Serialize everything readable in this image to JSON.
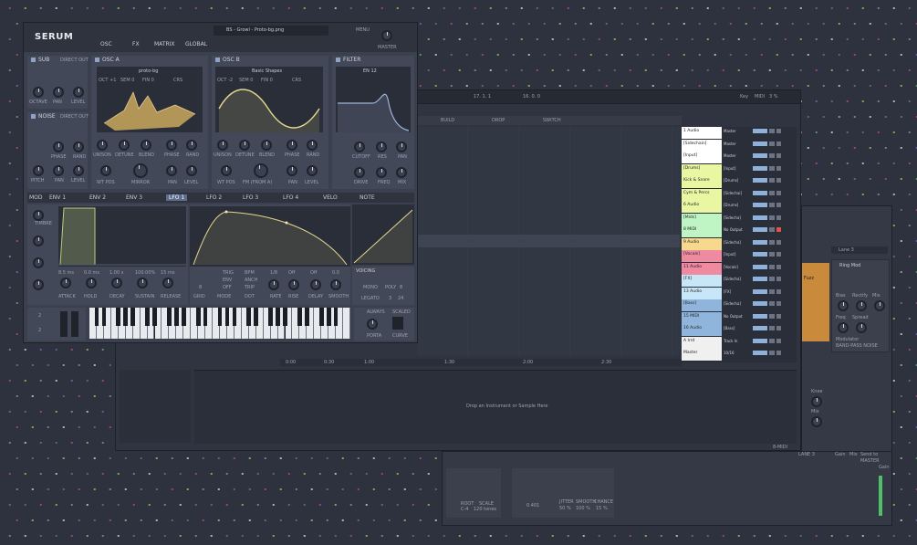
{
  "serum": {
    "logo": "SERUM",
    "tabs": [
      "OSC",
      "FX",
      "MATRIX",
      "GLOBAL"
    ],
    "preset_name": "BS - Growl - Proto-bg.png",
    "menu_label": "MENU",
    "master_label": "MASTER",
    "sub": {
      "title": "SUB",
      "direct_out": "DIRECT OUT",
      "labels": [
        "OCTAVE",
        "PAN",
        "LEVEL"
      ]
    },
    "noise": {
      "title": "NOISE",
      "direct_out": "DIRECT OUT",
      "labels": [
        "PHASE",
        "RAND",
        "PITCH",
        "PAN",
        "LEVEL"
      ]
    },
    "osc_a": {
      "title": "OSC A",
      "wavetable": "proto-bg",
      "params": [
        "OCT +1",
        "SEM 0",
        "FIN 0",
        "CRS"
      ],
      "labels": [
        "UNISON",
        "DETUNE",
        "BLEND",
        "PHASE",
        "RAND",
        "WT POS",
        "MIRROR",
        "PAN",
        "LEVEL"
      ]
    },
    "osc_b": {
      "title": "OSC B",
      "wavetable": "Basic Shapes",
      "params": [
        "OCT -2",
        "SEM 0",
        "FIN 0",
        "CRS"
      ],
      "labels": [
        "UNISON",
        "DETUNE",
        "BLEND",
        "PHASE",
        "RAND",
        "WT POS",
        "FM (FROM A)",
        "PAN",
        "LEVEL"
      ]
    },
    "filter": {
      "title": "FILTER",
      "type": "EN 12",
      "labels": [
        "CUTOFF",
        "RES",
        "PAN",
        "DRIVE",
        "FREQ",
        "MIX"
      ]
    },
    "mod_tabs": [
      "MOD",
      "ENV 1",
      "ENV 2",
      "ENV 3",
      "LFO 1",
      "LFO 2",
      "LFO 3",
      "LFO 4",
      "VELO",
      "NOTE"
    ],
    "env": {
      "values": [
        "8.5 ms",
        "0.0 ms",
        "1.00 s",
        "100.00%",
        "15 ms"
      ],
      "labels": [
        "ATTACK",
        "HOLD",
        "DECAY",
        "SUSTAIN",
        "RELEASE"
      ]
    },
    "lfo": {
      "values": [
        "1/8",
        "Off",
        "Off",
        "0.0"
      ],
      "labels": [
        "GRID",
        "MODE",
        "DOT",
        "RATE",
        "RISE",
        "DELAY",
        "SMOOTH"
      ],
      "options": [
        "TRIG",
        "ENV",
        "OFF",
        "BPM",
        "ANCH",
        "TRIP"
      ],
      "grid_value": "8"
    },
    "voicing": {
      "title": "VOICING",
      "mono": "MONO",
      "poly": "POLY",
      "poly_value": "8",
      "legato": "LEGATO",
      "legato_value": "3",
      "legato_total": "24"
    },
    "porta": {
      "always": "ALWAYS",
      "scaled": "SCALED",
      "porta": "PORTA",
      "curve": "CURVE"
    },
    "pitch_values": [
      "2",
      "2"
    ],
    "macro": "TIMBRE"
  },
  "daw": {
    "toolbar": {
      "position": "17.  1.  1",
      "loop_end": "16.  0.  0",
      "key": "Key",
      "midi": "MIDI",
      "cpu": "3 %"
    },
    "arrangement": {
      "markers": [
        "BUILD",
        "DROP",
        "SWITCH"
      ],
      "ruler": [
        "0:00",
        "0:30",
        "1:00",
        "1:30",
        "2:00",
        "2:30"
      ]
    },
    "tracks": [
      {
        "name": "1 Audio",
        "io": "Master",
        "color": "#ffffff"
      },
      {
        "name": "[Sidechain]",
        "io": "Master",
        "color": "#ffffff"
      },
      {
        "name": "[Input]",
        "io": "Master",
        "color": "#ffffff"
      },
      {
        "name": "[Drums]",
        "io": "[Input]",
        "color": "#e9f7a3"
      },
      {
        "name": "Kick & Snare",
        "io": "[Drums]",
        "color": "#e9f7a3"
      },
      {
        "name": "Cym & Percs",
        "io": "[Sidechai]",
        "color": "#e9f7a3"
      },
      {
        "name": "6 Audio",
        "io": "[Drums]",
        "color": "#e9f7a3"
      },
      {
        "name": "[Mids]",
        "io": "[Sidecha]",
        "color": "#bff5c4"
      },
      {
        "name": "8 MIDI",
        "io": "No Output",
        "color": "#bff5c4"
      },
      {
        "name": "9 Audio",
        "io": "[Sidecha]",
        "color": "#f7d98d"
      },
      {
        "name": "[Vocals]",
        "io": "[Input]",
        "color": "#f08aa0"
      },
      {
        "name": "11 Audio",
        "io": "[Vocals]",
        "color": "#f08aa0"
      },
      {
        "name": "[FX]",
        "io": "[Sidecha]",
        "color": "#c7e6f7"
      },
      {
        "name": "13 Audio",
        "io": "[FX]",
        "color": "#c7e6f7"
      },
      {
        "name": "[Bass]",
        "io": "[Sidecha]",
        "color": "#8fb5dc"
      },
      {
        "name": "15 MIDI",
        "io": "No Output",
        "color": "#8fb5dc"
      },
      {
        "name": "16 Audio",
        "io": "[Bass]",
        "color": "#8fb5dc"
      },
      {
        "name": "A Irrd",
        "io": "Track In",
        "color": "#f0f0f0"
      },
      {
        "name": "Master",
        "io": "10/16",
        "color": "#f0f0f0"
      }
    ],
    "drop_hint": "Drop an Instrument or Sample Here",
    "tab_label": "8-MIDI"
  },
  "effects": {
    "lane": "Lane 3",
    "ring_mod": "Ring Mod",
    "labels": [
      "Bias",
      "Rectify",
      "Mix",
      "Freq",
      "Spread"
    ],
    "modulator": "Modulator",
    "modulator_value": "BAND-PASS NOISE",
    "fuzz": "Fuzz",
    "knee": "Knee",
    "mix": "Mix",
    "gain": "Gain",
    "send_to": "Send to",
    "send_target": "MASTER",
    "lane_target": "LANE 3"
  },
  "mixer": {
    "labels": [
      "ROOT",
      "SCALE",
      "JITTER",
      "SMOOTH",
      "CHANCE"
    ],
    "values": [
      "0.401",
      "50 %",
      "100 %",
      "15 %"
    ],
    "root": "C-4",
    "scale": "120 tones",
    "gain": "Gain"
  },
  "colors": {
    "bg": "#2d323e",
    "serum_panel": "#3a404d",
    "accent": "#8fb0d8",
    "lfo": "#e6d88f"
  }
}
